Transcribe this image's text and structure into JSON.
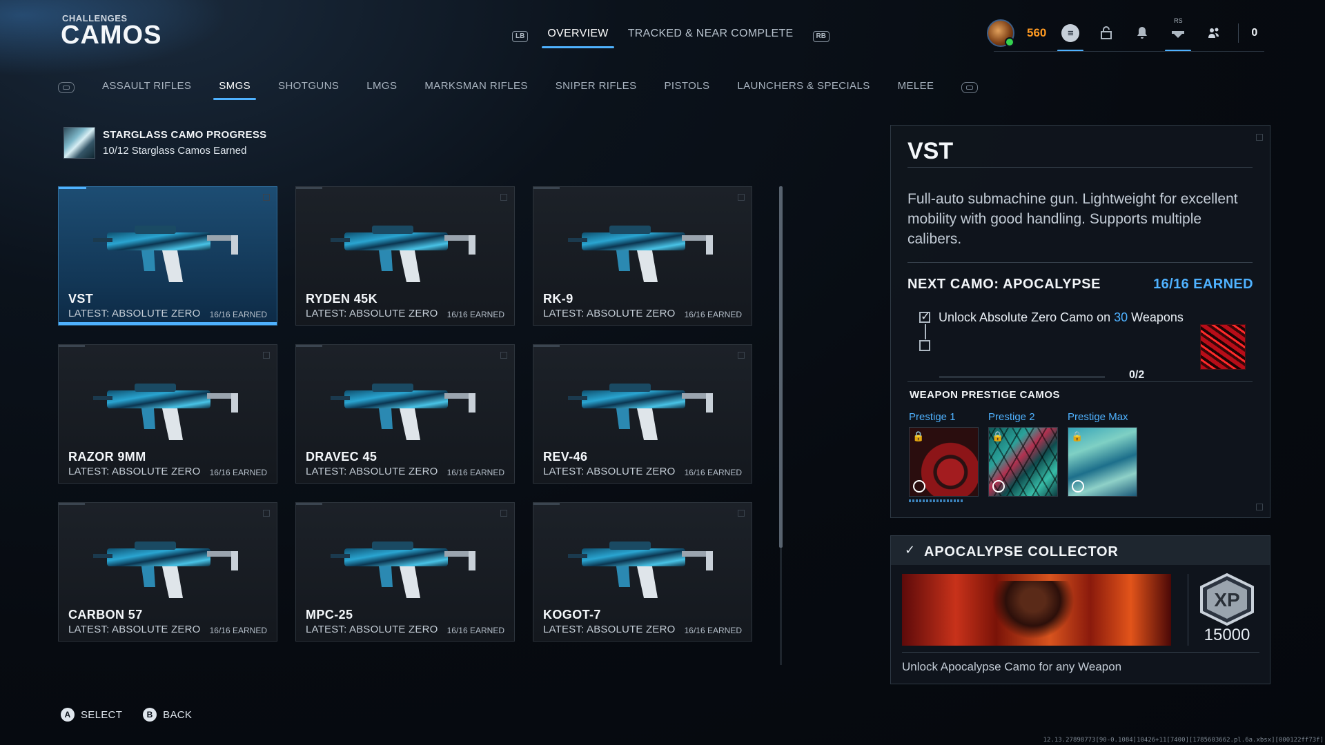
{
  "header": {
    "kicker": "CHALLENGES",
    "title": "CAMOS",
    "left_bumper": "LB",
    "right_bumper": "RB",
    "tabs": [
      {
        "label": "OVERVIEW",
        "active": true
      },
      {
        "label": "TRACKED & NEAR COMPLETE",
        "active": false
      }
    ]
  },
  "top_right": {
    "cod_points": "560",
    "rs_label": "RS",
    "party_count": "0",
    "icons": [
      "rank-emblem-icon",
      "list-icon",
      "store-icon",
      "bell-icon",
      "barracks-icon",
      "friends-icon"
    ]
  },
  "categories": [
    {
      "label": "ASSAULT RIFLES",
      "active": false
    },
    {
      "label": "SMGS",
      "active": true
    },
    {
      "label": "SHOTGUNS",
      "active": false
    },
    {
      "label": "LMGS",
      "active": false
    },
    {
      "label": "MARKSMAN RIFLES",
      "active": false
    },
    {
      "label": "SNIPER RIFLES",
      "active": false
    },
    {
      "label": "PISTOLS",
      "active": false
    },
    {
      "label": "LAUNCHERS & SPECIALS",
      "active": false
    },
    {
      "label": "MELEE",
      "active": false
    }
  ],
  "progress": {
    "title": "STARGLASS CAMO PROGRESS",
    "subtitle": "10/12 Starglass Camos Earned"
  },
  "weapons": [
    {
      "name": "VST",
      "latest": "LATEST: ABSOLUTE ZERO",
      "earned": "16/16 EARNED",
      "selected": true
    },
    {
      "name": "RYDEN 45K",
      "latest": "LATEST: ABSOLUTE ZERO",
      "earned": "16/16 EARNED",
      "selected": false
    },
    {
      "name": "RK-9",
      "latest": "LATEST: ABSOLUTE ZERO",
      "earned": "16/16 EARNED",
      "selected": false
    },
    {
      "name": "RAZOR 9MM",
      "latest": "LATEST: ABSOLUTE ZERO",
      "earned": "16/16 EARNED",
      "selected": false
    },
    {
      "name": "DRAVEC 45",
      "latest": "LATEST: ABSOLUTE ZERO",
      "earned": "16/16 EARNED",
      "selected": false
    },
    {
      "name": "REV-46",
      "latest": "LATEST: ABSOLUTE ZERO",
      "earned": "16/16 EARNED",
      "selected": false
    },
    {
      "name": "CARBON 57",
      "latest": "LATEST: ABSOLUTE ZERO",
      "earned": "16/16 EARNED",
      "selected": false
    },
    {
      "name": "MPC-25",
      "latest": "LATEST: ABSOLUTE ZERO",
      "earned": "16/16 EARNED",
      "selected": false
    },
    {
      "name": "KOGOT-7",
      "latest": "LATEST: ABSOLUTE ZERO",
      "earned": "16/16 EARNED",
      "selected": false
    }
  ],
  "detail": {
    "name": "VST",
    "description": "Full-auto submachine gun. Lightweight for excellent mobility with good handling. Supports multiple calibers.",
    "next_camo": "NEXT CAMO: APOCALYPSE",
    "earned": "16/16 EARNED",
    "task": {
      "text_before": "Unlock Absolute Zero Camo on ",
      "highlight": "30",
      "text_after": " Weapons",
      "completed": true
    },
    "progress": "0/2",
    "prestige_title": "WEAPON PRESTIGE CAMOS",
    "prestige": [
      {
        "label": "Prestige 1",
        "locked": true
      },
      {
        "label": "Prestige 2",
        "locked": true
      },
      {
        "label": "Prestige Max",
        "locked": true
      }
    ]
  },
  "collector": {
    "title": "APOCALYPSE COLLECTOR",
    "xp_label": "XP",
    "xp_amount": "15000",
    "description": "Unlock Apocalypse Camo for any Weapon"
  },
  "footer": [
    {
      "button": "A",
      "label": "SELECT"
    },
    {
      "button": "B",
      "label": "BACK"
    }
  ],
  "build_string": "12.13.27898773[90-0.1084]10426+11[7400][1785603662.pl.6a.xbsx][000122ff73f]",
  "colors": {
    "accent": "#4fb2ff",
    "cod_points": "#ff9a22",
    "selected_card": "#1d4d73"
  }
}
